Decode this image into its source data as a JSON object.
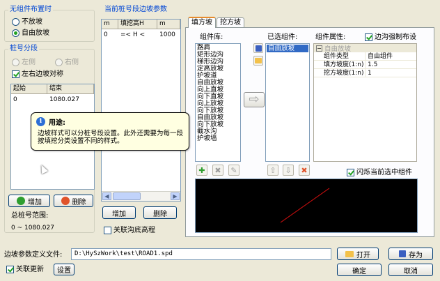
{
  "left": {
    "wuzujian_title": "无组件布置时",
    "radio_no_slope": "不放坡",
    "radio_free_slope": "自由放坡",
    "segment_title": "桩号分段",
    "radio_left": "左侧",
    "radio_right": "右侧",
    "symmetric_label": "左右边坡对称",
    "seg_headers": [
      "起始",
      "结束"
    ],
    "seg_rows": [
      [
        "0",
        "1080.027"
      ]
    ],
    "add_label": "增加",
    "delete_label": "删除",
    "total_range_label": "总桩号范围:",
    "total_range_value": "0 ~ 1080.027"
  },
  "tooltip": {
    "title": "用途:",
    "text": "边坡样式可以分桩号段设置。此外还需要为每一段按填挖分类设置不同的样式。"
  },
  "mid": {
    "title": "当前桩号段边坡参数",
    "headers": [
      "m",
      "填挖高H",
      "m"
    ],
    "rows": [
      [
        "0",
        "=< H <",
        "1000"
      ]
    ],
    "add_label": "增加",
    "delete_label": "删除",
    "link_label": "关联沟底高程"
  },
  "tabs": [
    "填方坡",
    "挖方坡"
  ],
  "tabpanel": {
    "lib_label": "组件库:",
    "lib_items": [
      "路肩",
      "矩形边沟",
      "梯形边沟",
      "定高放坡",
      "护坡道",
      "自由放坡",
      "向上直坡",
      "向下直坡",
      "向上放坡",
      "向下放坡",
      "自由放坡",
      "向下放坡",
      "截水沟",
      "护坡墙"
    ],
    "selected_label": "已选组件:",
    "selected_items": [
      "自由放坡"
    ],
    "props_label": "组件属性:",
    "force_label": "边沟强制布设",
    "props_group": "自由放坡",
    "props": [
      [
        "组件类型",
        "自由组件"
      ],
      [
        "填方坡度(1:n)",
        "1.5"
      ],
      [
        "挖方坡度(1:n)",
        "1"
      ]
    ],
    "flash_label": "闪烁当前选中组件"
  },
  "bottom": {
    "file_label": "边坡参数定义文件:",
    "file_value": "D:\\HySzWork\\test\\ROAD1.spd",
    "open_label": "打开",
    "save_label": "存为",
    "auto_update_label": "关联更新",
    "settings_label": "设置",
    "ok_label": "确定",
    "cancel_label": "取消"
  },
  "colors": {
    "accent": "#0046d5",
    "selection": "#316ac5",
    "preview_line": "#e01010"
  }
}
